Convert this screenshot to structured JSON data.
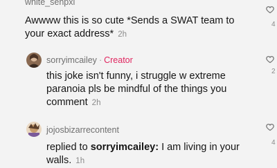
{
  "comments": [
    {
      "username": "white_senpxi",
      "text": "Awwww this is so cute *Sends a SWAT team to your exact address*",
      "time": "2h",
      "like_count_partial": "4"
    },
    {
      "username": "sorryimcailey",
      "badge": "Creator",
      "separator": "·",
      "text": "this joke isn't funny, i struggle w extreme paranoia pls be mindful of the things you comment",
      "time": "2h",
      "like_count_partial": "2"
    },
    {
      "username": "jojosbizarrecontent",
      "reply_prefix": "replied to",
      "reply_to": "sorryimcailey:",
      "text": "I am living in your walls.",
      "time": "1h",
      "like_count_partial": "4"
    }
  ],
  "icons": {
    "like": "heart-outline-icon"
  },
  "colors": {
    "background": "#f3f3f3",
    "creator_badge": "#e0245e",
    "muted": "#8a8a8a"
  }
}
